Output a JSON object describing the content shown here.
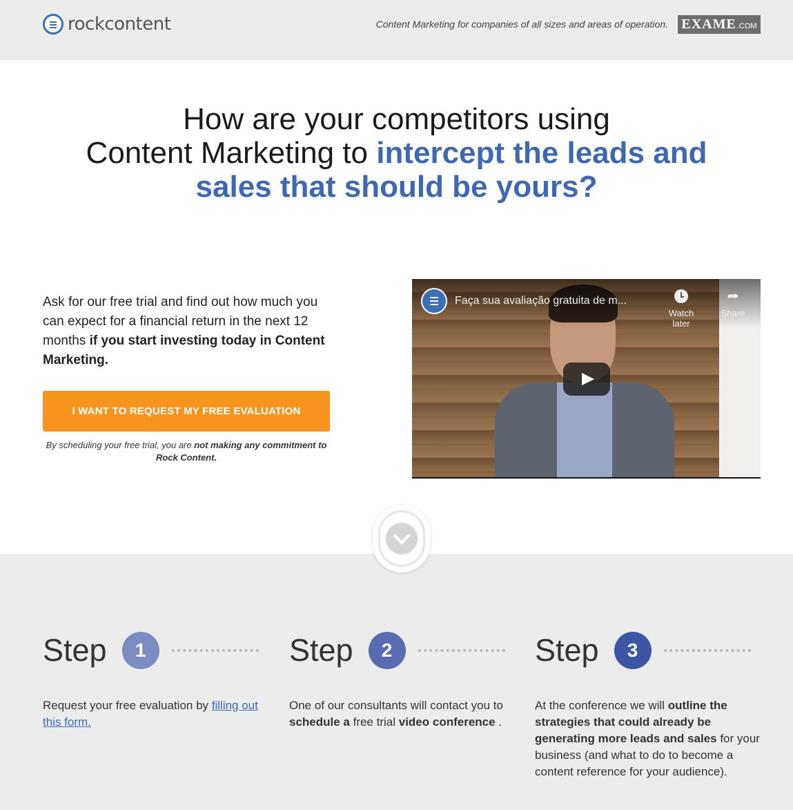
{
  "header": {
    "logo_text": "rockcontent",
    "tagline": "Content Marketing for companies of all sizes and areas of operation.",
    "exame_big": "EXAME",
    "exame_small": ".COM"
  },
  "headline": {
    "line1": "How are your competitors using",
    "line2_plain": "Content Marketing to ",
    "line2_blue": "intercept the leads and",
    "line3_blue": "sales that should be yours?"
  },
  "intro": {
    "text_plain": "Ask for our free trial and find out how much you can expect for a financial return in the next 12 months ",
    "text_bold": "if you start investing today in Content Marketing."
  },
  "cta": {
    "label": "I WANT TO REQUEST MY FREE EVALUATION"
  },
  "disclaimer": {
    "plain": "By scheduling your free trial, you are ",
    "bold": "not making any commitment to Rock Content."
  },
  "video": {
    "title": "Faça sua avaliação gratuita de m...",
    "watch_later": "Watch later",
    "share": "Share"
  },
  "steps": [
    {
      "word": "Step",
      "number": "1",
      "color": "#7d8bc3",
      "text_plain": "Request your free evaluation by ",
      "link": "filling out this form."
    },
    {
      "word": "Step",
      "number": "2",
      "color": "#5a6cb1",
      "t1": "One of our consultants will contact you to ",
      "b1": "schedule a",
      "t2": " free trial ",
      "b2": "video conference",
      "t3": " ."
    },
    {
      "word": "Step",
      "number": "3",
      "color": "#3c55a5",
      "t1": "At the conference we will ",
      "b1": "outline the strategies that could already be generating more leads and sales",
      "t2": " for your business (and what to do to become a content reference for your audience)."
    }
  ],
  "colors": {
    "accent_blue": "#3f68b3",
    "cta_orange": "#f7941d",
    "header_bg": "#ececec"
  }
}
